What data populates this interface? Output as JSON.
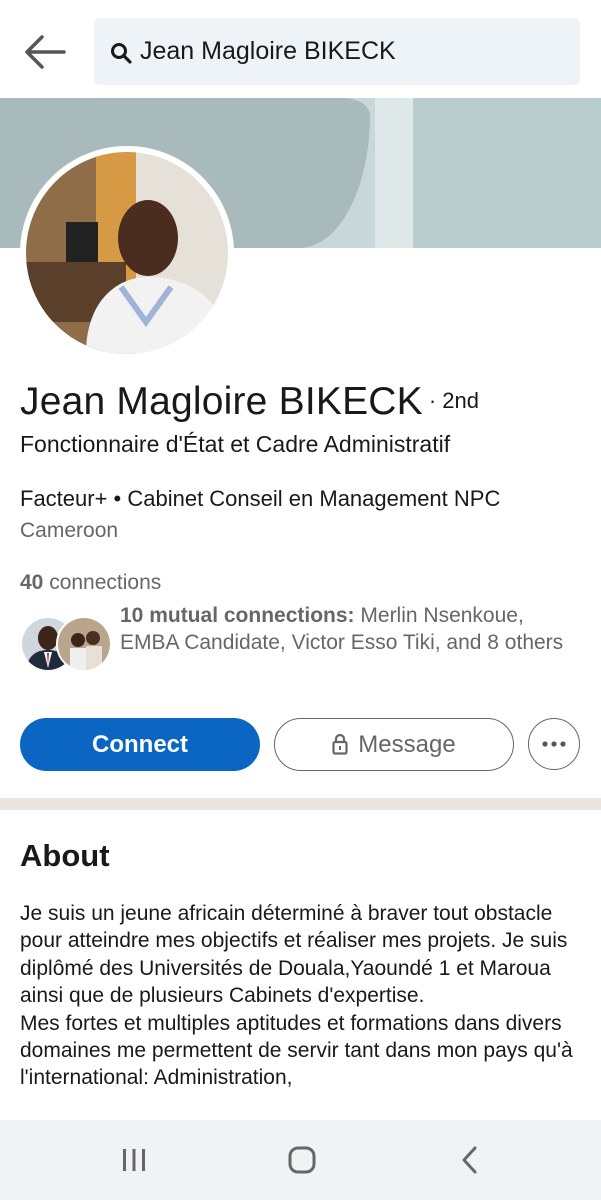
{
  "search": {
    "query": "Jean Magloire BIKECK"
  },
  "profile": {
    "name": "Jean Magloire BIKECK",
    "degree": "· 2nd",
    "headline": "Fonctionnaire d'État et Cadre Administratif",
    "company": "Facteur+ • Cabinet Conseil en Management NPC",
    "location": "Cameroon"
  },
  "connections": {
    "count": "40",
    "label": "connections",
    "mutual_bold": "10 mutual connections:",
    "mutual_rest": "Merlin Nsenkoue, EMBA Candidate, Victor Esso Tiki, and 8 others"
  },
  "actions": {
    "connect": "Connect",
    "message": "Message"
  },
  "about": {
    "title": "About",
    "paragraphs": [
      "Je suis un jeune africain déterminé à braver tout obstacle pour atteindre mes objectifs et réaliser mes projets. Je suis diplômé des Universités de Douala,Yaoundé 1 et Maroua ainsi que de plusieurs Cabinets d'expertise.",
      "Mes fortes et multiples aptitudes et formations dans divers domaines me permettent de servir tant dans mon pays qu'à l'international: Administration,"
    ]
  },
  "icons": {
    "back": "arrow-left-icon",
    "search": "search-icon",
    "lock": "lock-icon",
    "more": "more-horizontal-icon",
    "nav_recents": "recents-icon",
    "nav_home": "home-icon",
    "nav_back": "chevron-left-icon"
  },
  "colors": {
    "primary": "#0a66c2",
    "search_bg": "#eef3f8",
    "divider": "#e9e5df",
    "banner": "#c8d7da"
  }
}
